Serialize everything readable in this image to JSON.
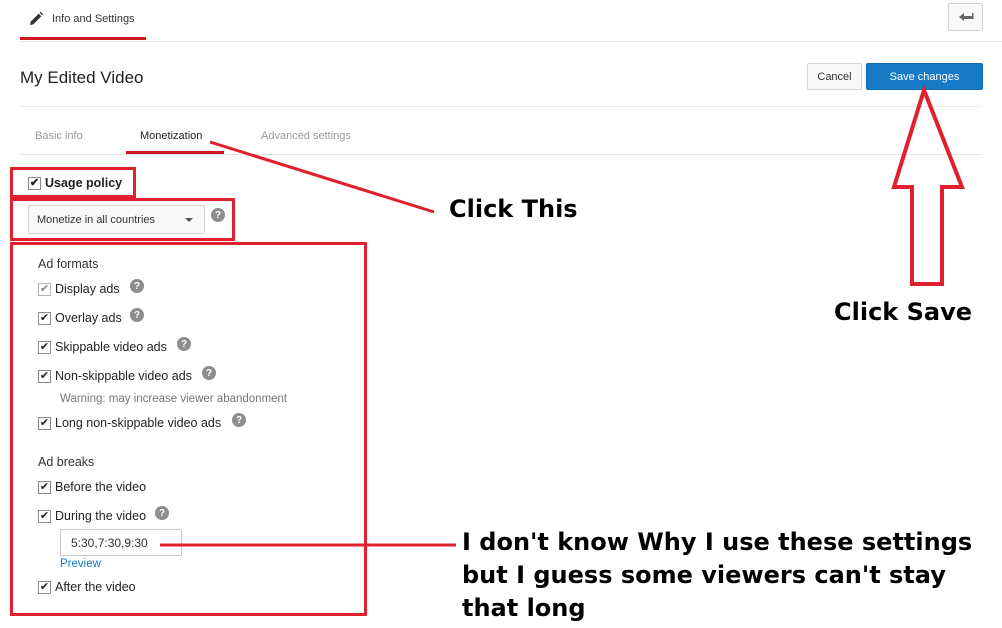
{
  "header": {
    "tab_label": "Info and Settings",
    "edit_icon": "pencil-icon",
    "back_icon": "back-arrow-icon"
  },
  "video": {
    "title": "My Edited Video"
  },
  "actions": {
    "cancel_label": "Cancel",
    "save_label": "Save changes"
  },
  "tabs": [
    {
      "label": "Basic info",
      "active": false
    },
    {
      "label": "Monetization",
      "active": true
    },
    {
      "label": "Advanced settings",
      "active": false
    }
  ],
  "monetization": {
    "usage_policy_label": "Usage policy",
    "usage_policy_checked": true,
    "country_select_value": "Monetize in all countries",
    "ad_formats_heading": "Ad formats",
    "ad_formats": [
      {
        "label": "Display ads",
        "checked": true,
        "disabled": true,
        "help": true
      },
      {
        "label": "Overlay ads",
        "checked": true,
        "help": true
      },
      {
        "label": "Skippable video ads",
        "checked": true,
        "help": true
      },
      {
        "label": "Non-skippable video ads",
        "checked": true,
        "help": true
      },
      {
        "label": "Long non-skippable video ads",
        "checked": true,
        "help": true
      }
    ],
    "warning": "Warning: may increase viewer abandonment",
    "ad_breaks_heading": "Ad breaks",
    "ad_breaks": [
      {
        "label": "Before the video",
        "checked": true
      },
      {
        "label": "During the video",
        "checked": true,
        "help": true
      },
      {
        "label": "After the video",
        "checked": true
      }
    ],
    "during_times_value": "5:30,7:30,9:30",
    "preview_link": "Preview"
  },
  "annotations": {
    "click_this": "Click This",
    "click_save": "Click Save",
    "note_line1": "I don't know Why I use these settings",
    "note_line2": "but I guess some viewers can't stay",
    "note_line3": "that long"
  },
  "colors": {
    "accent_red": "#cc181e",
    "annotation_red": "#e0202c",
    "primary_blue": "#167ac6"
  }
}
